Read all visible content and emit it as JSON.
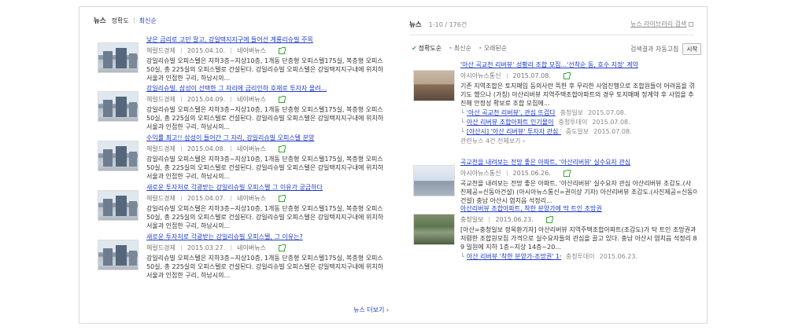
{
  "left": {
    "title": "뉴스",
    "sort_options": [
      "정확도",
      "최신순"
    ],
    "more": "뉴스 더보기 ›",
    "items": [
      {
        "headline": "낮은 금리로 고민 말고, 강일택지지구에 들어선 계룡리슈빌 주목",
        "source": "헤럴드경제",
        "date": "2015.04.10.",
        "portal": "네이버뉴스",
        "lines": [
          "강일리슈빌 오피스텔은 지하3층~지상10층, 1개동 단층형 오피스텔175실, 복층형 오피스텔",
          "50실, 총 225실의 오피스텔로 건설된다. 강일리슈빌 오피스텔은 강일택지지구내에 위치하여",
          "서울과 인접한 구리, 하남시의..."
        ]
      },
      {
        "headline": "강일리슈빌, 삼성이 선택한 그 자리에 금리인하 호재로 투자자 몰려...",
        "source": "헤럴드경제",
        "date": "2015.04.09.",
        "portal": "네이버뉴스",
        "lines": [
          "강일리슈빌 오피스텔은 지하3층~지상10층, 1개동 단층형 오피스텔175실, 복층형 오피스텔",
          "50실, 총 225실의 오피스텔로 건설된다. 강일리슈빌 오피스텔은 강일택지지구내에 위치하여",
          "서울과 인접한 구리, 하남시의..."
        ]
      },
      {
        "headline": "수익률 최고!! 삼성이 들어간 그 자리, 강일리슈빌 오피스텔 분양",
        "source": "헤럴드경제",
        "date": "2015.04.08.",
        "portal": "네이버뉴스",
        "lines": [
          "강일리슈빌 오피스텔은 지하3층~지상10층, 1개동 단층형 오피스텔175실, 복층형 오피스텔",
          "50실, 총 225실의 오피스텔로 건설된다. 강일리슈빌 오피스텔은 강일택지지구내에 위치하여",
          "서울과 인접한 구리, 하남시의..."
        ]
      },
      {
        "headline": "새로운 투자처로 각광받는 강일리슈빌 오피스텔 그 이유가 궁금하다",
        "source": "헤럴드경제",
        "date": "2015.04.07.",
        "portal": "네이버뉴스",
        "lines": [
          "강일리슈빌 오피스텔은 지하3층~지상10층, 1개동 단층형 오피스텔175실, 복층형 오피스텔",
          "50실, 총 225실의 오피스텔로 건설된다. 강일리슈빌 오피스텔은 강일택지지구내에 위치하여",
          "서울과 인접한 구리, 하남시의..."
        ]
      },
      {
        "headline": "새로운 투자처로 각광받는 강일리슈빌 오피스텔, 그 이유는?",
        "source": "헤럴드경제",
        "date": "2015.03.27.",
        "portal": "네이버뉴스",
        "lines": [
          "강일리슈빌 오피스텔은 지하3층~지상10층, 1개동 단층형 오피스텔175실, 복층형 오피스텔",
          "50실, 총 225실의 오피스텔로 건설된다. 강일리슈빌 오피스텔은 강일택지지구내에 위치하여",
          "서울과 인접한 구리, 하남시의..."
        ]
      }
    ]
  },
  "right": {
    "title": "뉴스",
    "count": "1-10 / 176건",
    "library": "뉴스 라이브러리 검색",
    "sort_options": [
      "정확도순",
      "최신순",
      "오래된순"
    ],
    "auto_label": "검색결과 자동고침",
    "start_label": "시작",
    "items": [
      {
        "headline": "'아산 곡교천 리버뷰' 성황리 조합 모집...'선착순 동, 호수 지정' 계약",
        "source": "아시아뉴스통신",
        "date": "2015.07.08.",
        "lines": [
          "기존 지역조합은 토지매입 등의사란 뜩한 후 무리한 사업진행으로 조합원들이 어려움을 겪",
          "기도 했으나 (가칭) 아산리버뷰 지역주택조합아파트의 경우 토지매매 정계약 후 사업을 추",
          "진해 안정성 확보로 조합 모집에..."
        ],
        "subs": [
          {
            "title": "'아산 곡교천 리버뷰', 관심 뜨겁다",
            "source": "충청일보",
            "date": "2015.07.08."
          },
          {
            "title": "아산 리버뷰 조합아파트 인기몰이",
            "source": "충청투데이",
            "date": "2015.07.08."
          },
          {
            "title": "[아산시] '아산 리버뷰' 투자자 관심 한...",
            "source": "중도일보",
            "date": "2015.07.08."
          }
        ],
        "related": "관련뉴스 4건 전체보기 ›"
      },
      {
        "headline": "곡교천을 내려보는 전망 좋은 아파트, '아산리버뷰' 실수요자 관심",
        "source": "아시아뉴스통신",
        "date": "2015.06.26.",
        "lines": [
          "곡교천을 내려보는 전망 좋은 아파트, '아산리버뷰' 실수요자 관심 아산리버뷰 조감도.(사",
          "진제공=신동아건설) (아시아뉴스통신=권이상 기자) 아산리버뷰 조감도.(사진제공=신동아",
          "건설) 충남 아산시 염치읍 석정리..."
        ],
        "subs": [],
        "related": ""
      },
      {
        "headline": "아산리버뷰 조합아파트, 착한 분양가에 딱 트인 조망권",
        "source": "충청일보",
        "date": "2015.06.23.",
        "lines": [
          "[아산=충청일보 정옥환기자] 아산리버뷰 지역주택조합아파트(조감도)가 탁 트인 조망권과",
          "저렴한 조합원모집 가격으로 실수요자들의 관심을 끌고 있다. 충남 아산시 염치읍 석정리 84",
          "9 일원에 지하 1층~지상 14층~20..."
        ],
        "subs": [
          {
            "title": "아산 리버뷰 '착한 분양가-조망권' 1석2조",
            "source": "충청투데이",
            "date": "2015.06.23."
          }
        ],
        "related": ""
      }
    ]
  }
}
